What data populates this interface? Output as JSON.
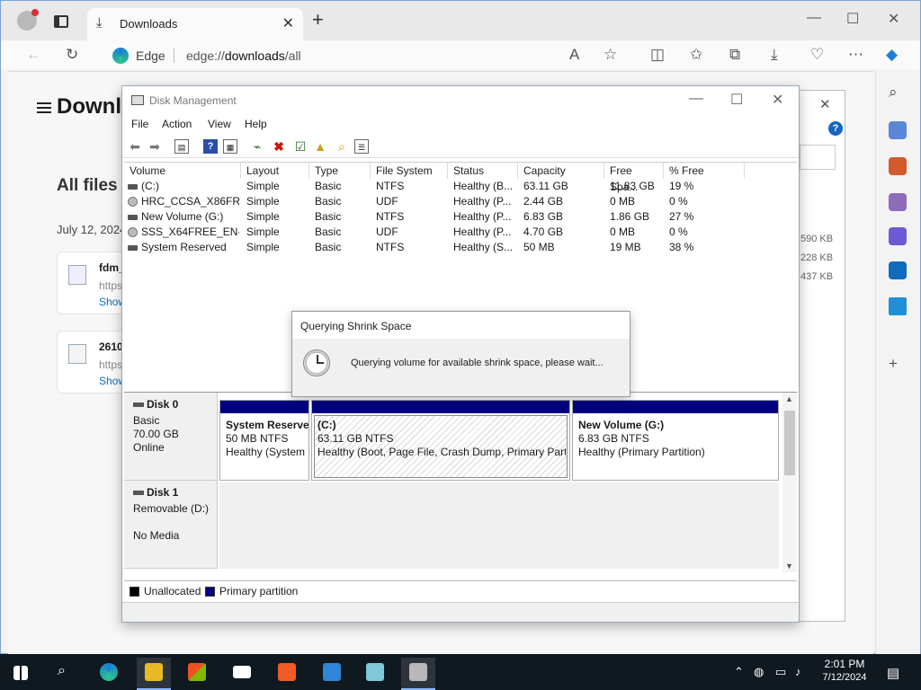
{
  "browser": {
    "tab_title": "Downloads",
    "address_label": "Edge",
    "url_prefix": "edge://",
    "url_bold": "downloads",
    "url_suffix": "/all",
    "page_title": "Downlo",
    "section_title": "All files",
    "date_header": "July 12, 2024",
    "items": [
      {
        "name": "fdm_",
        "url": "https:",
        "action": "Show"
      },
      {
        "name": "2610",
        "url": "https:",
        "action": "Show"
      }
    ],
    "sizes": [
      "590 KB",
      "228 KB",
      "437 KB"
    ]
  },
  "disk_management": {
    "title": "Disk Management",
    "menu": [
      "File",
      "Action",
      "View",
      "Help"
    ],
    "columns": [
      "Volume",
      "Layout",
      "Type",
      "File System",
      "Status",
      "Capacity",
      "Free Spa...",
      "% Free"
    ],
    "volumes": [
      {
        "volume": "(C:)",
        "layout": "Simple",
        "type": "Basic",
        "fs": "NTFS",
        "status": "Healthy (B...",
        "capacity": "63.11 GB",
        "free": "11.83 GB",
        "pct": "19 %",
        "icon": "disk"
      },
      {
        "volume": "HRC_CCSA_X86FR...",
        "layout": "Simple",
        "type": "Basic",
        "fs": "UDF",
        "status": "Healthy (P...",
        "capacity": "2.44 GB",
        "free": "0 MB",
        "pct": "0 %",
        "icon": "cd"
      },
      {
        "volume": "New Volume (G:)",
        "layout": "Simple",
        "type": "Basic",
        "fs": "NTFS",
        "status": "Healthy (P...",
        "capacity": "6.83 GB",
        "free": "1.86 GB",
        "pct": "27 %",
        "icon": "disk"
      },
      {
        "volume": "SSS_X64FREE_EN-...",
        "layout": "Simple",
        "type": "Basic",
        "fs": "UDF",
        "status": "Healthy (P...",
        "capacity": "4.70 GB",
        "free": "0 MB",
        "pct": "0 %",
        "icon": "cd"
      },
      {
        "volume": "System Reserved",
        "layout": "Simple",
        "type": "Basic",
        "fs": "NTFS",
        "status": "Healthy (S...",
        "capacity": "50 MB",
        "free": "19 MB",
        "pct": "38 %",
        "icon": "disk"
      }
    ],
    "disks": [
      {
        "name": "Disk 0",
        "type": "Basic",
        "size": "70.00 GB",
        "state": "Online",
        "partitions": [
          {
            "name": "System Reserve",
            "size_fs": "50 MB NTFS",
            "status": "Healthy (System"
          },
          {
            "name": "(C:)",
            "size_fs": "63.11 GB NTFS",
            "status": "Healthy (Boot, Page File, Crash Dump, Primary Partit"
          },
          {
            "name": "New Volume  (G:)",
            "size_fs": "6.83 GB NTFS",
            "status": "Healthy (Primary Partition)"
          }
        ]
      },
      {
        "name": "Disk 1",
        "type": "Removable (D:)",
        "size": "",
        "state": "No Media"
      }
    ],
    "legend": [
      {
        "label": "Unallocated",
        "color": "#000000"
      },
      {
        "label": "Primary partition",
        "color": "#000080"
      }
    ]
  },
  "dialog": {
    "title": "Querying Shrink Space",
    "message": "Querying volume for available shrink space, please wait..."
  },
  "taskbar": {
    "time": "2:01 PM",
    "date": "7/12/2024"
  },
  "colors": {
    "primary_partition": "#000080",
    "taskbar": "#101820",
    "link": "#0f6cbd"
  }
}
